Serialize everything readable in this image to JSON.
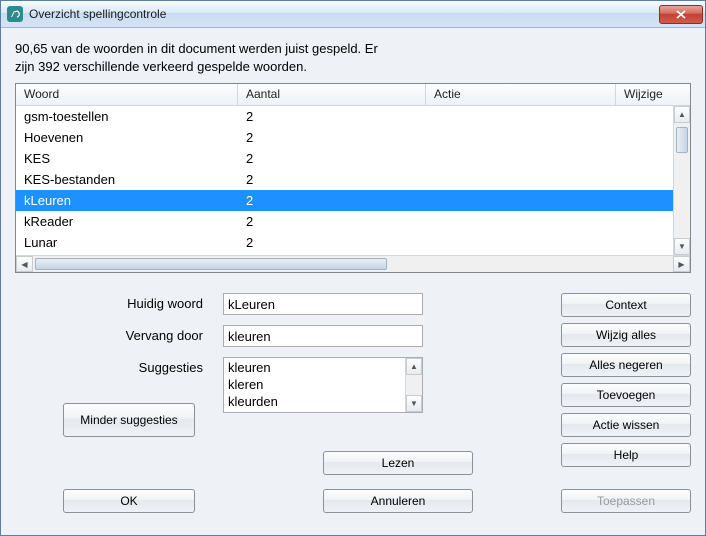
{
  "window": {
    "title": "Overzicht spellingcontrole"
  },
  "summary": {
    "line1": "90,65 van de woorden in dit document werden juist gespeld. Er",
    "line2": "zijn 392 verschillende verkeerd gespelde woorden."
  },
  "grid": {
    "columns": {
      "woord": "Woord",
      "aantal": "Aantal",
      "actie": "Actie",
      "wijzigen": "Wijzige"
    },
    "col_widths": {
      "woord": 222,
      "aantal": 188,
      "actie": 190,
      "wijzigen": 60
    },
    "rows": [
      {
        "woord": "gsm-toestellen",
        "aantal": "2",
        "selected": false
      },
      {
        "woord": "Hoevenen",
        "aantal": "2",
        "selected": false
      },
      {
        "woord": "KES",
        "aantal": "2",
        "selected": false
      },
      {
        "woord": "KES-bestanden",
        "aantal": "2",
        "selected": false
      },
      {
        "woord": "kLeuren",
        "aantal": "2",
        "selected": true
      },
      {
        "woord": "kReader",
        "aantal": "2",
        "selected": false
      },
      {
        "woord": "Lunar",
        "aantal": "2",
        "selected": false
      }
    ]
  },
  "form": {
    "current_label": "Huidig woord",
    "current_value": "kLeuren",
    "replace_label": "Vervang door",
    "replace_value": "kleuren",
    "suggest_label": "Suggesties",
    "suggestions": [
      "kleuren",
      "kleren",
      "kleurden"
    ]
  },
  "buttons": {
    "context": "Context",
    "wijzig_alles": "Wijzig alles",
    "alles_negeren": "Alles negeren",
    "toevoegen": "Toevoegen",
    "actie_wissen": "Actie wissen",
    "help": "Help",
    "minder": "Minder suggesties",
    "lezen": "Lezen",
    "annuleren": "Annuleren",
    "ok": "OK",
    "toepassen": "Toepassen"
  }
}
